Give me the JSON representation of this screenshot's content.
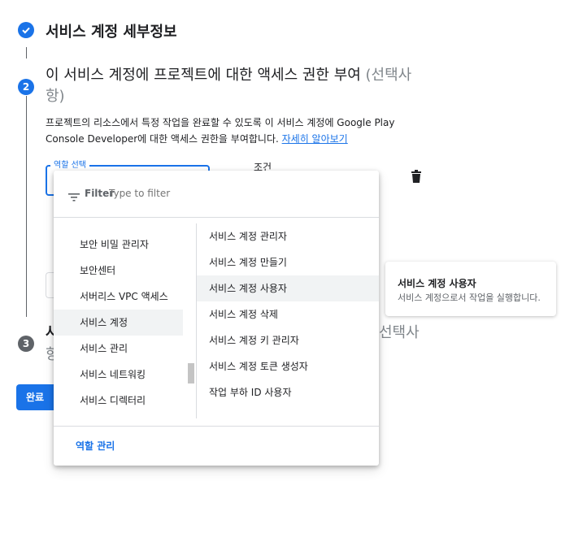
{
  "steps": [
    {
      "number": "",
      "title": "서비스 계정 세부정보"
    },
    {
      "number": "2",
      "title_main": "이 서비스 계정에 프로젝트에 대한 액세스 권한 부여 ",
      "title_optional": "(선택사항)",
      "description": "프로젝트의 리소스에서 특정 작업을 완료할 수 있도록 이 서비스 계정에 Google Play Console Developer에 대한 액세스 권한을 부여합니다. ",
      "learn_more": "자세히 알아보기"
    },
    {
      "number": "3",
      "title_fragment_right": "선택사",
      "title_fragment_left": "사",
      "title_fragment_line2": "항"
    }
  ],
  "role_field": {
    "label": "역할 선택"
  },
  "condition": {
    "label": "조건"
  },
  "done_button": "완료",
  "filter": {
    "label": "Filter",
    "placeholder": "Type to filter"
  },
  "left_list": [
    "보안 비밀 관리자",
    "보안센터",
    "서버리스 VPC 액세스",
    "서비스 계정",
    "서비스 관리",
    "서비스 네트워킹",
    "서비스 디렉터리"
  ],
  "left_selected_index": 3,
  "right_list": [
    "서비스 계정 관리자",
    "서비스 계정 만들기",
    "서비스 계정 사용자",
    "서비스 계정 삭제",
    "서비스 계정 키 관리자",
    "서비스 계정 토큰 생성자",
    "작업 부하 ID 사용자"
  ],
  "right_selected_index": 2,
  "manage_roles": "역할 관리",
  "tooltip": {
    "title": "서비스 계정 사용자",
    "description": "서비스 계정으로서 작업을 실행합니다."
  },
  "colors": {
    "accent": "#1a73e8",
    "step_done": "#1a73e8",
    "step_inactive": "#5f6368"
  }
}
